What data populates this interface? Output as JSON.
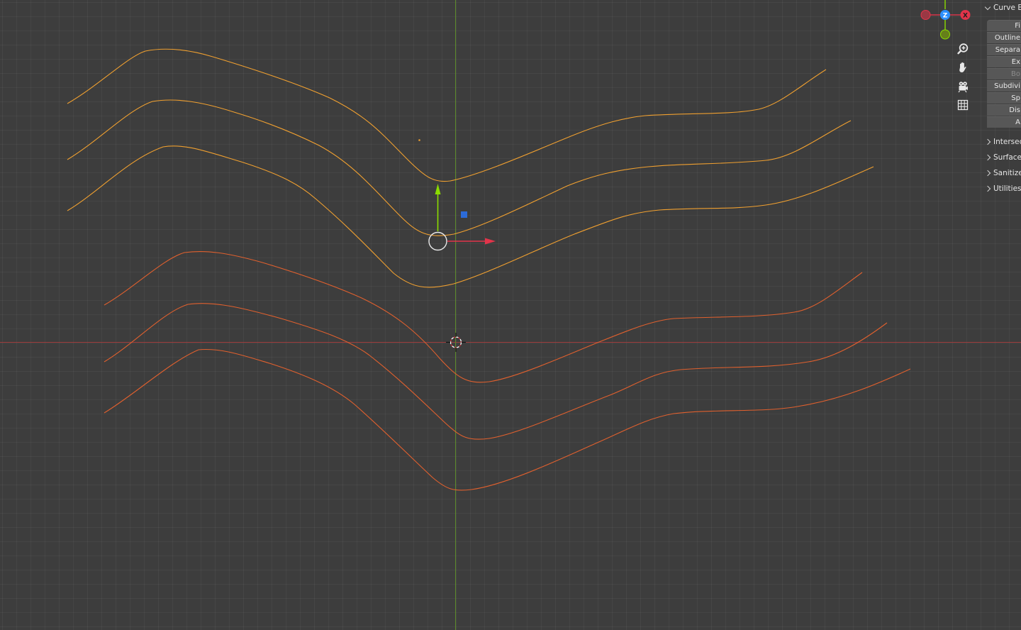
{
  "gizmo": {
    "z_label": "Z",
    "x_label": "X",
    "colors": {
      "x": "#e2344a",
      "y": "#8bdc00",
      "z": "#2c8fff"
    }
  },
  "nav_buttons": [
    {
      "name": "zoom-icon"
    },
    {
      "name": "hand-pan-icon"
    },
    {
      "name": "camera-icon"
    },
    {
      "name": "grid-ortho-icon"
    }
  ],
  "panel": {
    "title": "Curve Ed",
    "buttons": [
      {
        "label": "Fi",
        "enabled": true
      },
      {
        "label": "Outline",
        "enabled": true
      },
      {
        "label": "Separa",
        "enabled": true
      },
      {
        "label": "Ex",
        "enabled": true
      },
      {
        "label": "Bo",
        "enabled": false
      },
      {
        "label": "Subdivi",
        "enabled": true
      },
      {
        "label": "Sp",
        "enabled": true
      },
      {
        "label": "Dis",
        "enabled": true
      },
      {
        "label": "A",
        "enabled": true
      }
    ],
    "sections": [
      {
        "label": "Intersect"
      },
      {
        "label": "Surfaces"
      },
      {
        "label": "Sanitize"
      },
      {
        "label": "Utilities"
      }
    ]
  },
  "colors": {
    "background": "#3d3d3d",
    "selected_curve": "#f0a030",
    "unselected_curve": "#e0602e",
    "x_axis_line": "#9b3a3a",
    "y_axis_line": "#5c8a2a"
  }
}
